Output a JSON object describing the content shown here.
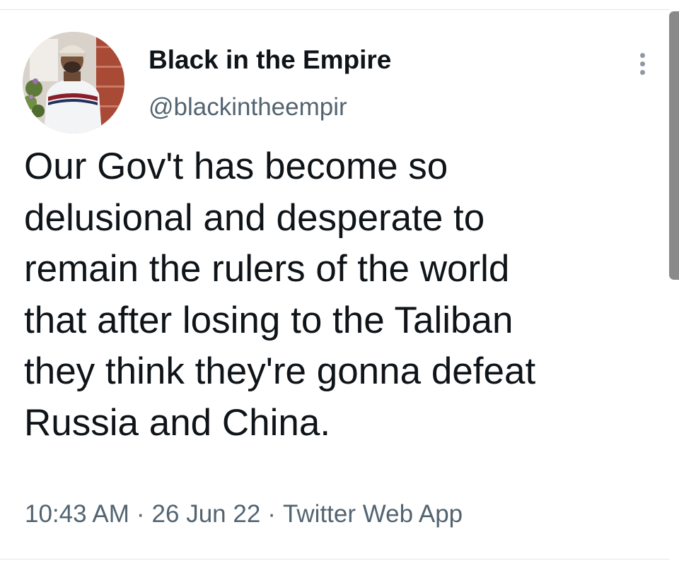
{
  "tweet": {
    "author": {
      "display_name": "Black in the Empire",
      "handle": "@blackintheempir",
      "avatar_icon": "profile-photo"
    },
    "more_icon": "more-options-icon",
    "text_lines": [
      "Our Gov't has become so",
      "delusional and desperate to",
      "remain the rulers of the world",
      "that after losing to the Taliban",
      "they think they're gonna defeat",
      "Russia and China."
    ],
    "meta": {
      "time": "10:43 AM",
      "separator": "·",
      "date": "26 Jun 22",
      "source": "Twitter Web App"
    }
  },
  "colors": {
    "text": "#0f1419",
    "secondary": "#536471",
    "divider": "#e6e6e6",
    "scrollbar": "#8a8a8a"
  }
}
